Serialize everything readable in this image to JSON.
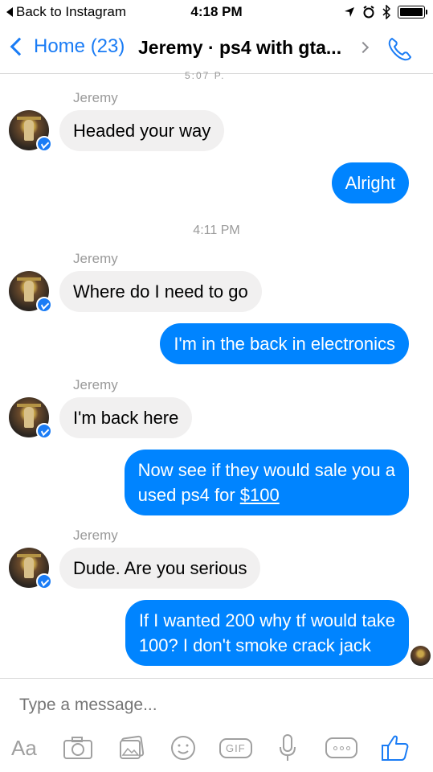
{
  "status_bar": {
    "back_label": "Back to Instagram",
    "time": "4:18 PM",
    "icons": [
      "location-arrow-icon",
      "alarm-icon",
      "bluetooth-icon",
      "battery-icon"
    ]
  },
  "nav": {
    "back_label": "Home (23)",
    "title": "Jeremy · ps4 with gta...",
    "accent_color": "#1a7cf5"
  },
  "thread": {
    "time_fragment": "5:07 P.",
    "messages": [
      {
        "sender": "Jeremy",
        "text": "Headed your way",
        "direction": "in"
      },
      {
        "text": "Alright",
        "direction": "out"
      },
      {
        "timestamp": "4:11 PM"
      },
      {
        "sender": "Jeremy",
        "text": "Where do I need to go",
        "direction": "in"
      },
      {
        "text": "I'm in the back in electronics",
        "direction": "out"
      },
      {
        "sender": "Jeremy",
        "text": "I'm back here",
        "direction": "in"
      },
      {
        "text_line1": "Now see if they would sale you a",
        "text_line2_prefix": "used ps4 for ",
        "link": "$100",
        "direction": "out"
      },
      {
        "sender": "Jeremy",
        "text": "Dude. Are you serious",
        "direction": "in"
      },
      {
        "text_line1": "If I wanted 200 why tf would take",
        "text_line2": "100? I don't smoke crack jack",
        "direction": "out"
      }
    ],
    "outgoing_color": "#0084ff",
    "incoming_color": "#f1f0f0"
  },
  "composer": {
    "placeholder": "Type a message...",
    "aa_label": "Aa",
    "gif_label": "GIF",
    "tools": [
      "aa-button",
      "camera-icon",
      "photo-gallery-icon",
      "emoji-icon",
      "gif-button",
      "microphone-icon",
      "more-icon",
      "like-icon"
    ]
  }
}
